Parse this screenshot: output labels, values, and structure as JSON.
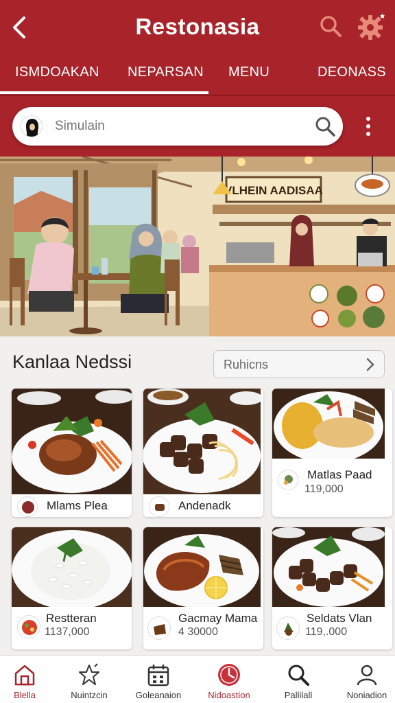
{
  "app": {
    "title": "Restonasia"
  },
  "tabs": [
    {
      "label": "ISMDOAKAN"
    },
    {
      "label": "NEPARSAN"
    },
    {
      "label": "MENU"
    },
    {
      "label": "DEONASS"
    }
  ],
  "search": {
    "placeholder": "Simulain"
  },
  "hero": {
    "sign_text": "VLHEIN AADISAA"
  },
  "section": {
    "title": "Kanlaa Nedssi",
    "action_label": "Ruhicns"
  },
  "dishes": [
    {
      "name": "Mlams Plea",
      "price": ""
    },
    {
      "name": "Andenadk",
      "price": ""
    },
    {
      "name": "Matlas Paad",
      "price": "119,000"
    },
    {
      "name": "Restteran",
      "price": "1137,000"
    },
    {
      "name": "Gacmay Mama",
      "price": "4 30000"
    },
    {
      "name": "Seldats Vlan",
      "price": "119,.000"
    }
  ],
  "bottom_nav": [
    {
      "label": "Blella",
      "icon": "home-icon",
      "active": true
    },
    {
      "label": "Nuintzcin",
      "icon": "star-icon",
      "active": false
    },
    {
      "label": "Goleanaion",
      "icon": "calendar-icon",
      "active": false
    },
    {
      "label": "Nidoastion",
      "icon": "clock-icon",
      "active": true
    },
    {
      "label": "Pallilall",
      "icon": "search-icon",
      "active": false
    },
    {
      "label": "Noniadion",
      "icon": "user-icon",
      "active": false
    }
  ],
  "colors": {
    "brand": "#a8232a",
    "header_dark": "#8c1a20",
    "icon_accent": "#e8897a"
  }
}
